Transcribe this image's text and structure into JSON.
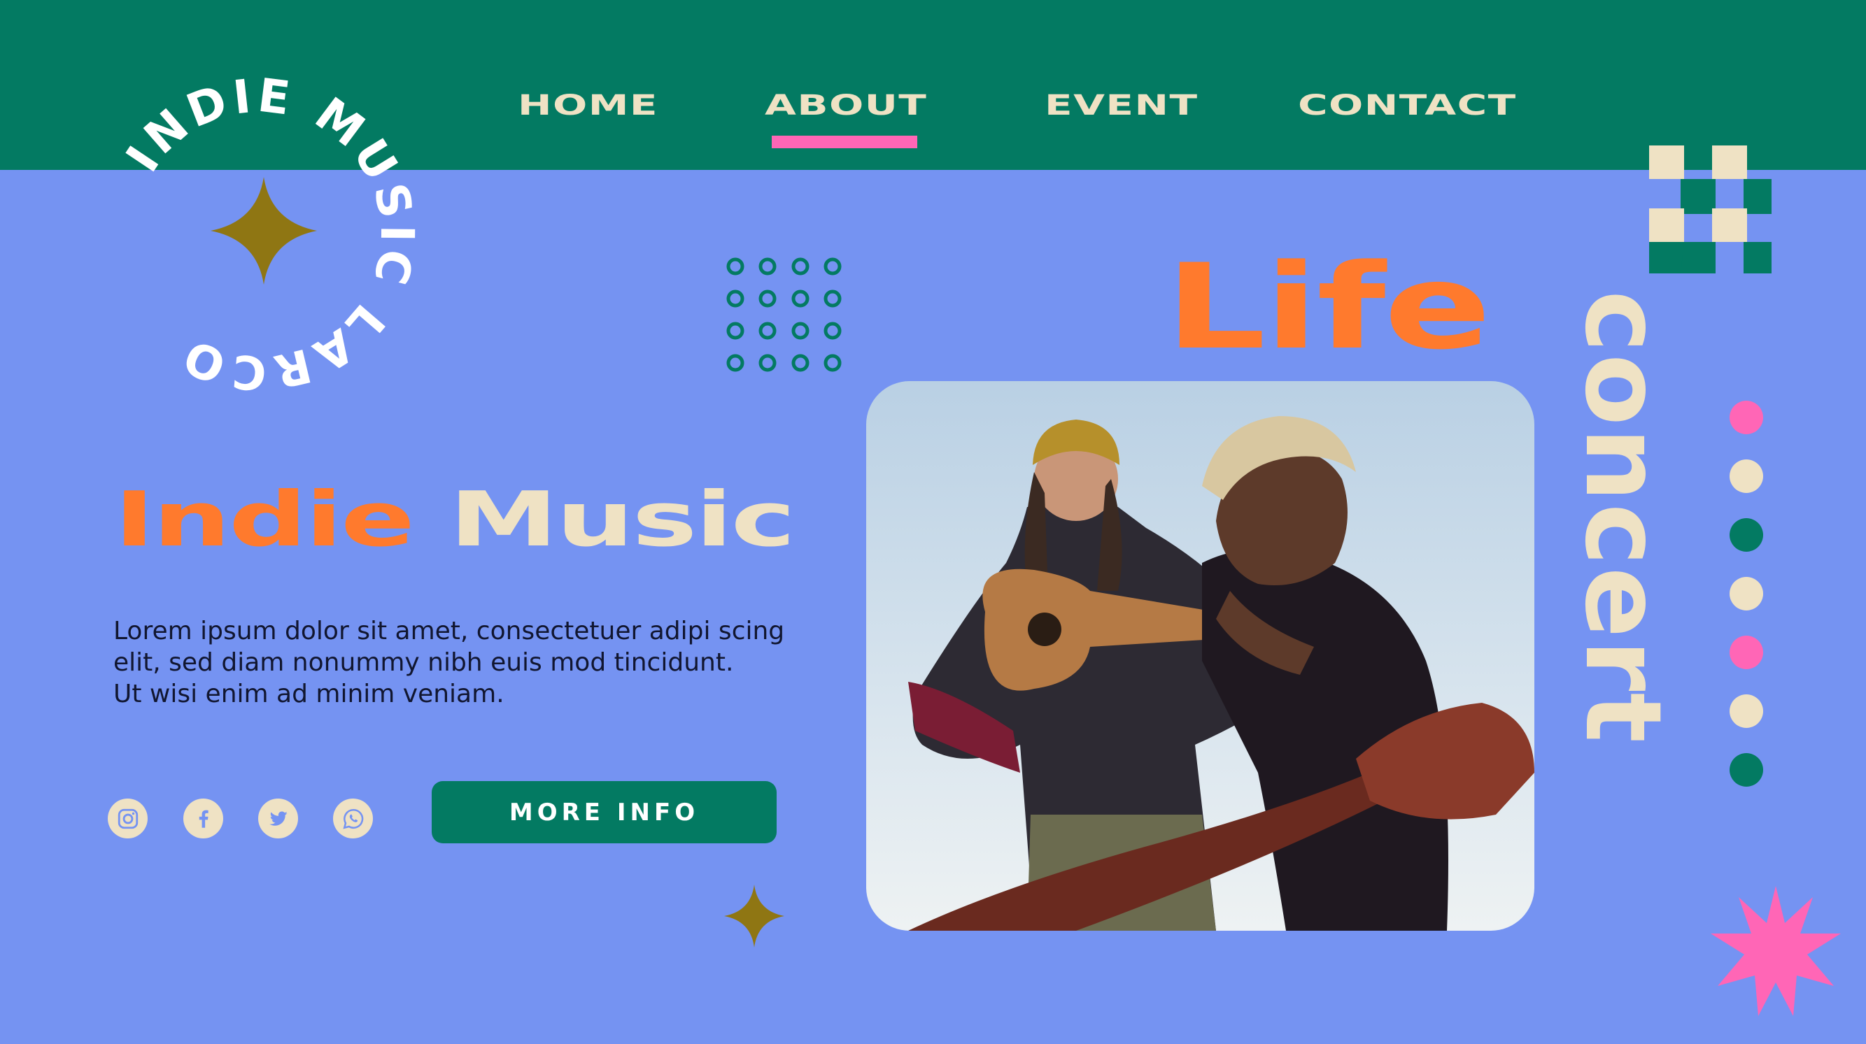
{
  "logo": {
    "ring_text": "INDIE MUSIC LARCO"
  },
  "nav": {
    "items": [
      {
        "label": "HOME"
      },
      {
        "label": "ABOUT"
      },
      {
        "label": "EVENT"
      },
      {
        "label": "CONTACT"
      }
    ],
    "active": "ABOUT"
  },
  "hero": {
    "headline_word1": "Indie",
    "headline_word2": "Music",
    "body_lines": [
      "Lorem ipsum dolor sit amet, consectetuer adipi scing",
      "elit, sed diam nonummy nibh euis mod tincidunt.",
      "Ut wisi enim ad minim veniam."
    ],
    "cta_label": "MORE INFO"
  },
  "social": [
    {
      "icon": "instagram-icon"
    },
    {
      "icon": "facebook-icon"
    },
    {
      "icon": "twitter-icon"
    },
    {
      "icon": "whatsapp-icon"
    }
  ],
  "feature": {
    "word_life": "Life",
    "word_concert": "concert"
  },
  "colors": {
    "background": "#7593f2",
    "topbar": "#037a62",
    "accent_orange": "#ff7a2d",
    "cream": "#efe2c4",
    "pink": "#ff66b6",
    "olive": "#8f7613"
  }
}
